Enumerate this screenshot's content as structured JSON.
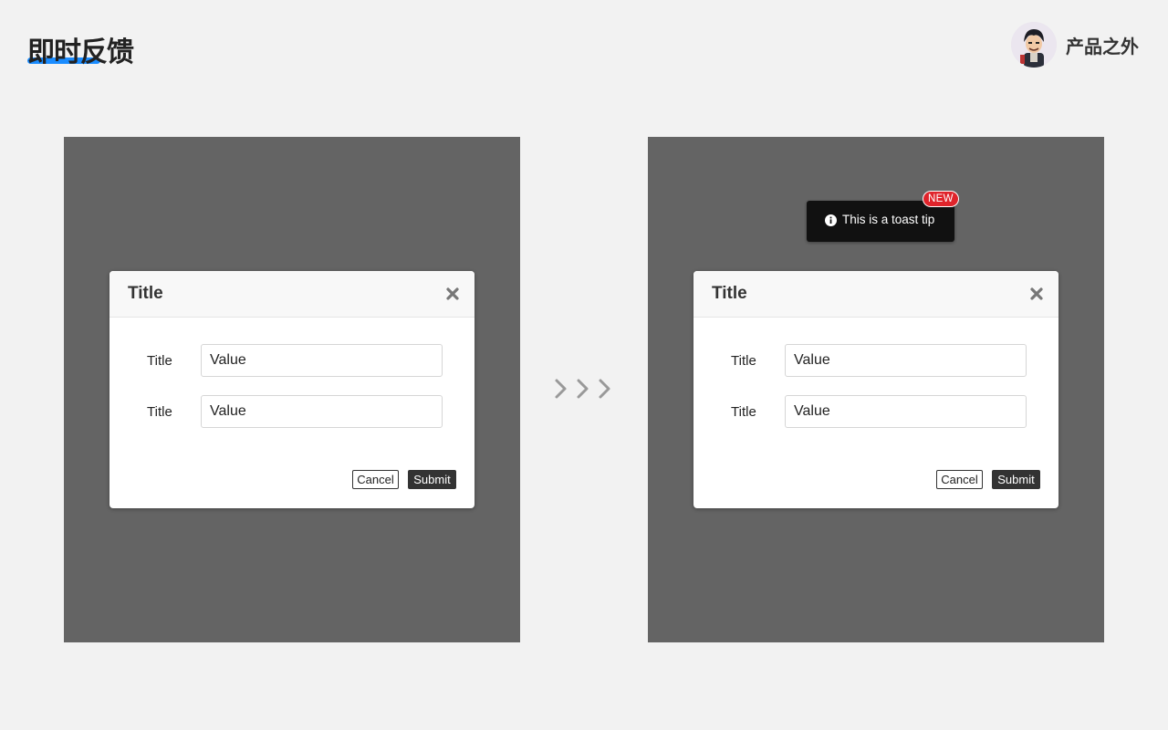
{
  "header": {
    "title": "即时反馈",
    "brand": "产品之外"
  },
  "colors": {
    "accent": "#1a8cff",
    "panel": "#646464",
    "badge": "#e0242b",
    "toast": "#111111"
  },
  "before": {
    "dialog": {
      "title": "Title",
      "close_icon": "close-icon",
      "fields": [
        {
          "label": "Title",
          "value": "Value"
        },
        {
          "label": "Title",
          "value": "Value"
        }
      ],
      "cancel_label": "Cancel",
      "submit_label": "Submit"
    }
  },
  "transition_icon": "triple-chevron-right-icon",
  "after": {
    "toast": {
      "icon": "info-icon",
      "text": "This is a toast tip",
      "badge": "NEW"
    },
    "dialog": {
      "title": "Title",
      "close_icon": "close-icon",
      "fields": [
        {
          "label": "Title",
          "value": "Value"
        },
        {
          "label": "Title",
          "value": "Value"
        }
      ],
      "cancel_label": "Cancel",
      "submit_label": "Submit"
    }
  }
}
